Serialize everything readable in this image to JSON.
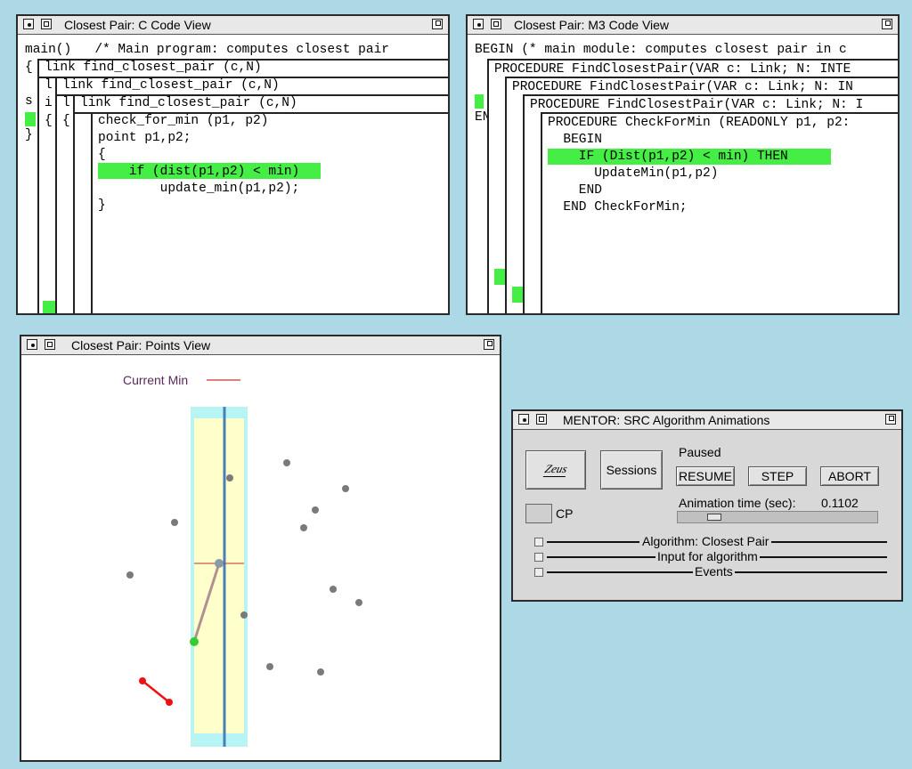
{
  "c_window": {
    "title": "Closest Pair: C Code View",
    "pane1_lines": [
      "main()   /* Main program: computes closest pair"
    ],
    "pane1_bracket": "{",
    "pane1_close": "}",
    "pane1_cut": [
      "l:",
      "i",
      "s",
      "{",
      "i"
    ],
    "pane2_header": "link find_closest_pair (c,N)",
    "pane2_cut": [
      "l:",
      "i",
      "{",
      "i:"
    ],
    "pane3_header": "link find_closest_pair (c,N)",
    "pane3_cut": [
      "l:",
      "{"
    ],
    "pane4_header": "link find_closest_pair (c,N)",
    "pane4_lines": [
      "check_for_min (p1, p2)",
      "point p1,p2;",
      "{",
      "    if (dist(p1,p2) < min)",
      "        update_min(p1,p2);",
      "}"
    ]
  },
  "m3_window": {
    "title": "Closest Pair: M3 Code View",
    "pane1_line": "BEGIN (* main module: computes closest pair in c",
    "pane1_end": "EN",
    "pane2_header": "PROCEDURE FindClosestPair(VAR c: Link; N: INTE",
    "pane3_header": "PROCEDURE FindClosestPair(VAR c: Link; N: IN",
    "pane4_header": "PROCEDURE FindClosestPair(VAR c: Link; N: I",
    "pane5_lines": [
      "PROCEDURE CheckForMin (READONLY p1, p2:",
      "  BEGIN",
      "    IF (Dist(p1,p2) < min) THEN",
      "      UpdateMin(p1,p2)",
      "    END",
      "  END CheckForMin;"
    ]
  },
  "points_window": {
    "title": "Closest Pair: Points View",
    "legend_label": "Current Min",
    "colors": {
      "strip": "#ffffcc",
      "strip_border": "#b8f4f4",
      "divider": "#4a7fb8",
      "point": "#7a7a7a",
      "min_pair": "#ee1111",
      "candidate_line": "#b39090",
      "green_point": "#33cc33"
    }
  },
  "mentor_window": {
    "title": "MENTOR: SRC Algorithm Animations",
    "zeus_label": "Zeus",
    "sessions_label": "Sessions",
    "status": "Paused",
    "resume_label": "RESUME",
    "step_label": "STEP",
    "abort_label": "ABORT",
    "anim_time_label": "Animation time (sec):",
    "anim_time_value": "0.1102",
    "anim_speed_fraction": 0.16,
    "cp_label": "CP",
    "algorithm_label": "Algorithm:  Closest Pair",
    "input_label": "Input for algorithm",
    "events_label": "Events"
  }
}
